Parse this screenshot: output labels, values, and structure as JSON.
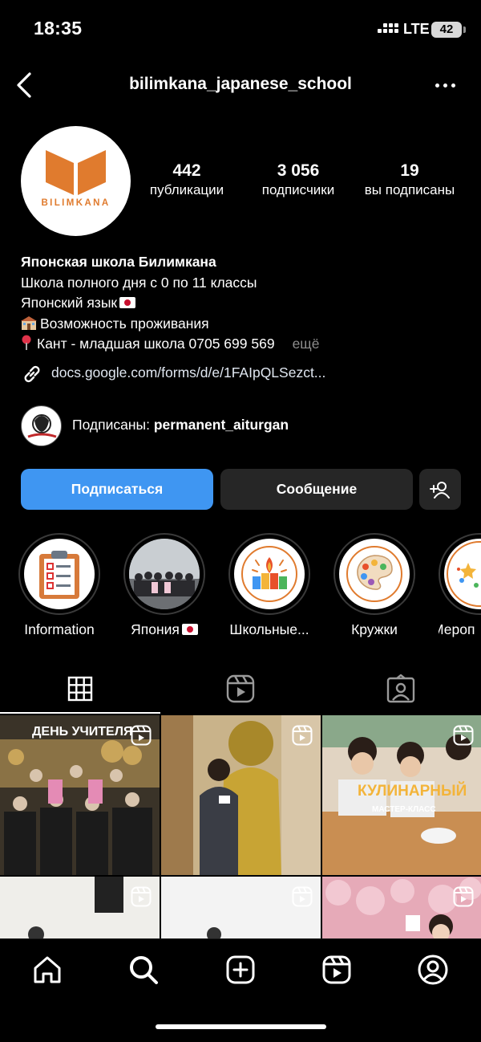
{
  "status_bar": {
    "time": "18:35",
    "network": "LTE",
    "battery": "42"
  },
  "header": {
    "username": "bilimkana_japanese_school",
    "back_icon": "chevron-left-icon",
    "more_icon": "ellipsis-icon"
  },
  "profile": {
    "avatar_text": "BILIMKANA",
    "stats": [
      {
        "value": "442",
        "label": "публикации"
      },
      {
        "value": "3 056",
        "label": "подписчики"
      },
      {
        "value": "19",
        "label": "вы подписаны"
      }
    ],
    "bio": {
      "name": "Японская школа Билимкана",
      "line1": "Школа полного дня с 0 по 11 классы",
      "line2": "Японский язык",
      "line3": "Возможность проживания",
      "line4": "Кант - младшая школа 0705 699 569",
      "more": "ещё"
    },
    "link": "docs.google.com/forms/d/e/1FAIpQLSezct...",
    "followed_by": {
      "prefix": "Подписаны: ",
      "user": "permanent_aiturgan"
    }
  },
  "actions": {
    "follow": "Подписаться",
    "message": "Сообщение"
  },
  "highlights": [
    {
      "label": "Information",
      "icon": "clipboard-icon"
    },
    {
      "label": "Япония",
      "icon": "photo-thumbnail"
    },
    {
      "label": "Школьные...",
      "icon": "celebration-icon"
    },
    {
      "label": "Кружки",
      "icon": "palette-icon"
    },
    {
      "label": "Мероп",
      "icon": "stars-icon"
    }
  ],
  "tabs": [
    "grid-icon",
    "reels-icon",
    "tagged-icon"
  ],
  "posts": [
    {
      "caption": "ДЕНЬ УЧИТЕЛЯ",
      "type": "reel"
    },
    {
      "caption": "",
      "type": "reel"
    },
    {
      "caption": "КУЛИНАРНЫЙ",
      "subcaption": "МАСТЕР-КЛАСС",
      "type": "reel"
    },
    {
      "caption": "",
      "type": "reel"
    },
    {
      "caption": "",
      "type": "reel"
    },
    {
      "caption": "",
      "type": "reel"
    }
  ],
  "bottom_nav": [
    "home-icon",
    "search-icon",
    "create-icon",
    "reels-icon",
    "profile-icon"
  ],
  "colors": {
    "accent": "#3f96f2",
    "brand_orange": "#e07b2e",
    "button_dark": "#262626",
    "muted": "#8e8e8e"
  }
}
